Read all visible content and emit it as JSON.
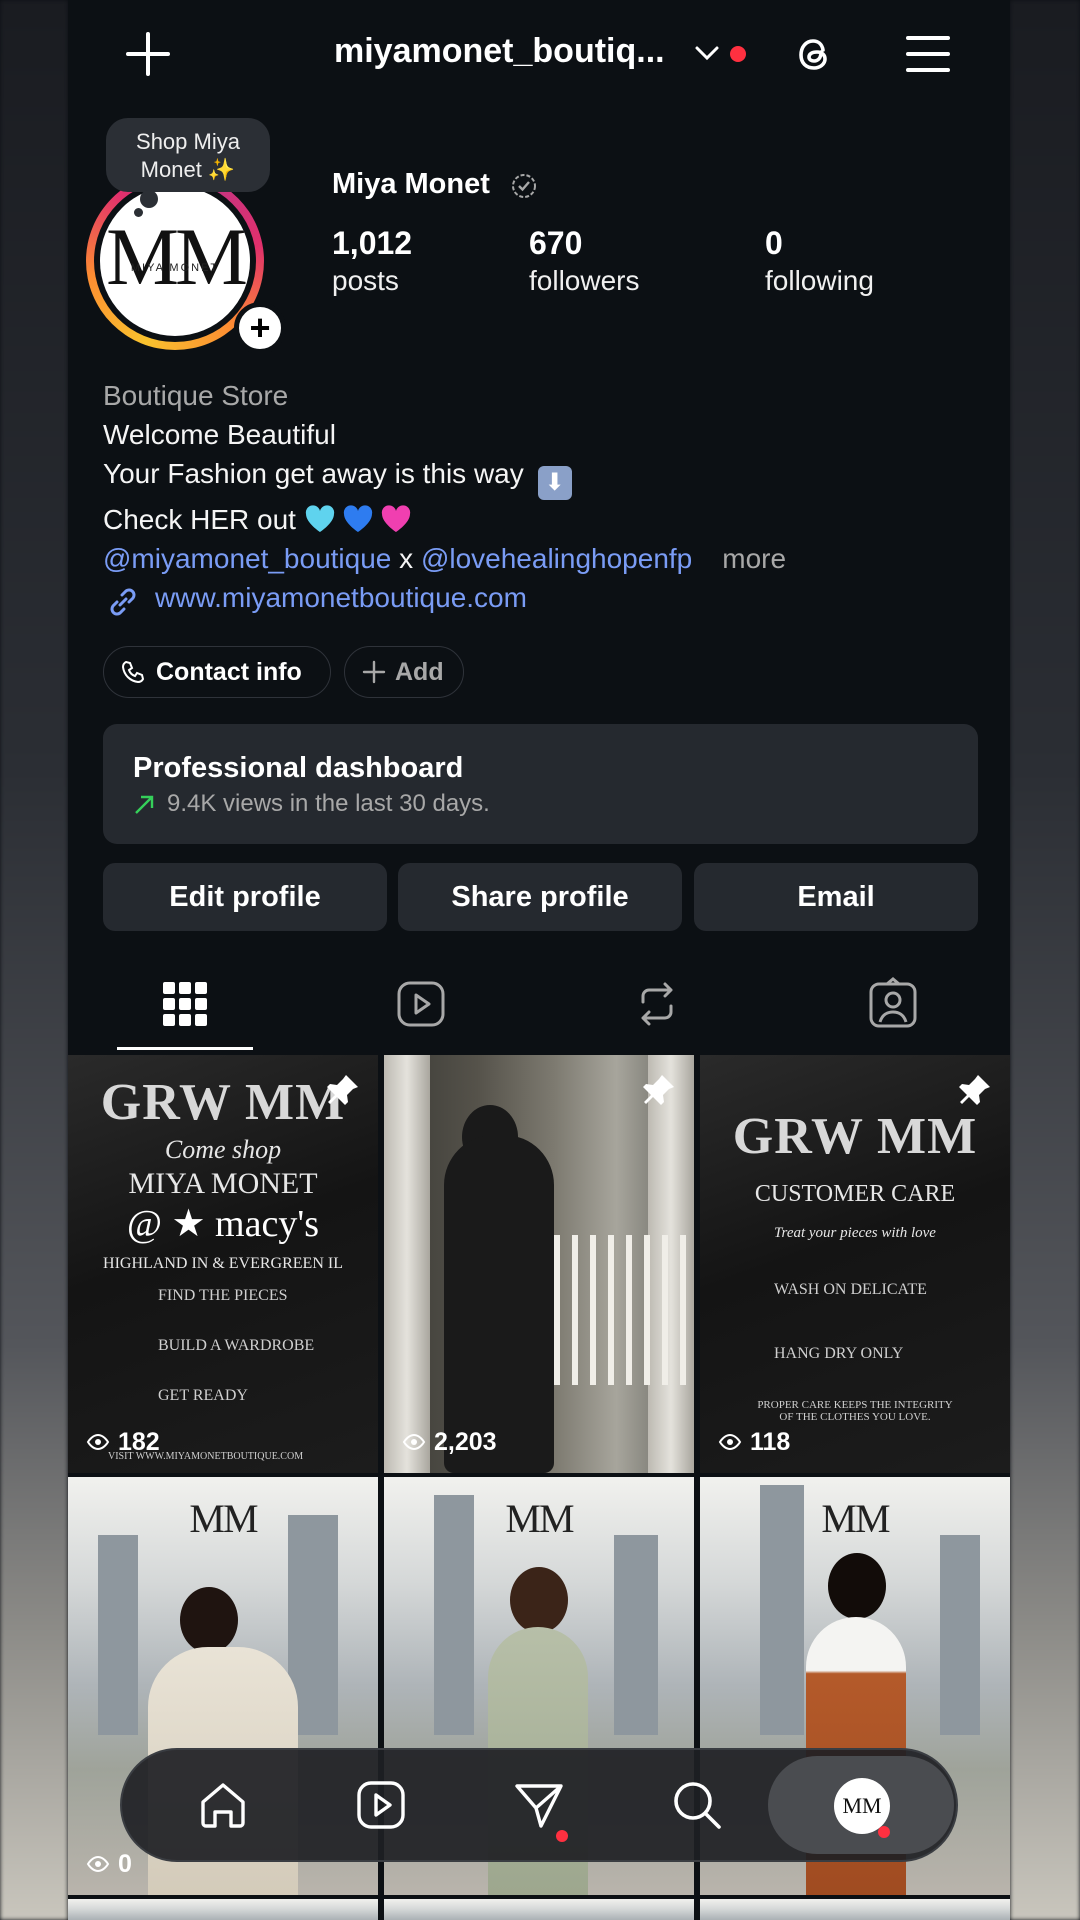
{
  "topbar": {
    "username": "miyamonet_boutiq...",
    "icons": [
      "plus-icon",
      "chevron-down-icon",
      "threads-icon",
      "menu-icon"
    ]
  },
  "note": {
    "text_line1": "Shop Miya",
    "text_line2": "Monet ✨"
  },
  "avatar": {
    "monogram": "MM",
    "brand": "MIYA MONET"
  },
  "profile": {
    "name": "Miya Monet",
    "stats": [
      {
        "value": "1,012",
        "label": "posts"
      },
      {
        "value": "670",
        "label": "followers"
      },
      {
        "value": "0",
        "label": "following"
      }
    ]
  },
  "bio": {
    "category": "Boutique Store",
    "line1": "Welcome Beautiful",
    "line2": "Your Fashion get away is this way",
    "line3": "Check HER out",
    "mention1": "@miyamonet_boutique",
    "separator": "x",
    "mention2": "@lovehealinghopenfp",
    "more": "more",
    "link": "www.miyamonetboutique.com"
  },
  "chips": {
    "contact": "Contact info",
    "add": "Add"
  },
  "dashboard": {
    "title": "Professional dashboard",
    "subtitle": "9.4K views in the last 30 days."
  },
  "buttons": {
    "edit": "Edit profile",
    "share": "Share profile",
    "email": "Email"
  },
  "tabs": [
    "grid",
    "reels",
    "reposts",
    "tagged"
  ],
  "posts": [
    {
      "heading_top": "GRW",
      "logo": "MM",
      "line1": "Come shop",
      "line2": "MIYA MONET",
      "line3": "@ ★ macy's",
      "line4": "HIGHLAND IN & EVERGREEN IL",
      "bullet1": "FIND THE PIECES",
      "bullet2": "BUILD A WARDROBE",
      "bullet3": "GET READY",
      "footer": "VISIT WWW.MIYAMONETBOUTIQUE.COM",
      "views": "182",
      "pinned": true
    },
    {
      "views": "2,203",
      "pinned": true
    },
    {
      "heading_top": "GRW",
      "logo": "MM",
      "line1": "CUSTOMER CARE",
      "line2": "Treat your pieces with love",
      "bullet1": "WASH ON DELICATE",
      "bullet2": "HANG DRY ONLY",
      "footer": "PROPER CARE KEEPS THE INTEGRITY OF THE CLOTHES YOU LOVE.",
      "views": "118",
      "pinned": true
    },
    {
      "logo": "MM",
      "views": "0"
    },
    {
      "logo": "MM"
    },
    {
      "logo": "MM"
    }
  ],
  "nav": {
    "items": [
      "home",
      "reels",
      "messages",
      "search",
      "profile"
    ]
  },
  "colors": {
    "accent_link": "#7a9cf5",
    "notification": "#ff3040",
    "surface": "#25292f",
    "background": "#0c1014"
  }
}
